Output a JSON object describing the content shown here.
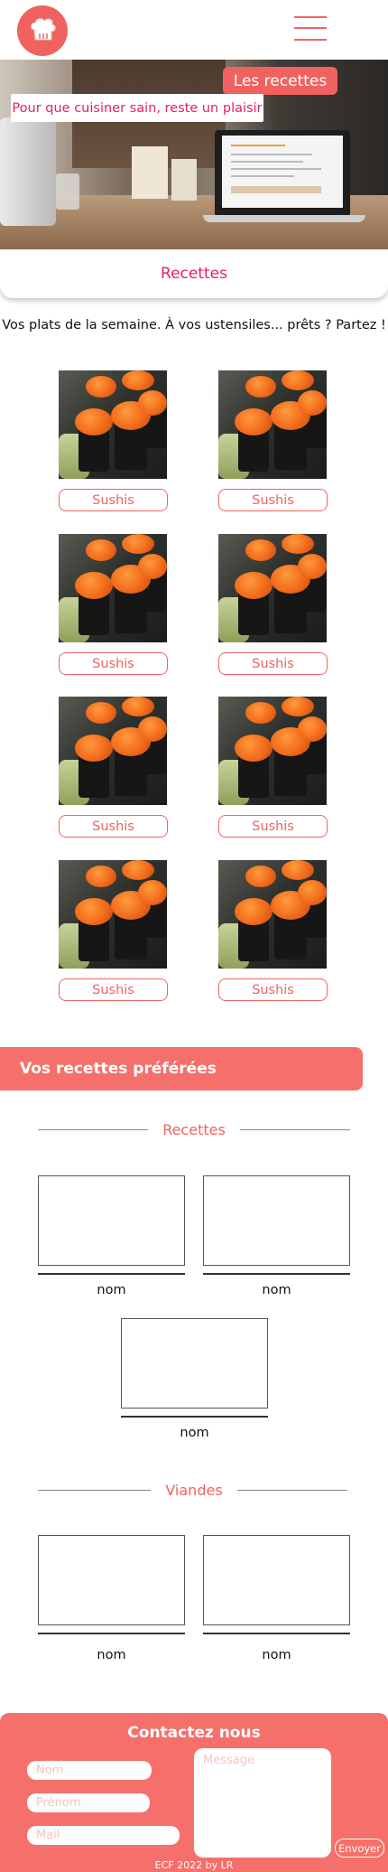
{
  "header": {
    "logo_icon": "chef-hat-icon",
    "menu_icon": "hamburger-menu-icon"
  },
  "hero": {
    "button_label": "Les recettes",
    "slogan": "Pour que cuisiner sain, reste un plaisir"
  },
  "tab": {
    "label": "Recettes"
  },
  "intro": "Vos plats de la semaine. À vos ustensiles... prêts ? Partez !",
  "weekly_recipes": [
    {
      "label": "Sushis"
    },
    {
      "label": "Sushis"
    },
    {
      "label": "Sushis"
    },
    {
      "label": "Sushis"
    },
    {
      "label": "Sushis"
    },
    {
      "label": "Sushis"
    },
    {
      "label": "Sushis"
    },
    {
      "label": "Sushis"
    }
  ],
  "favorites": {
    "banner": "Vos recettes préférées",
    "sections": [
      {
        "title": "Recettes",
        "items": [
          {
            "name": "nom"
          },
          {
            "name": "nom"
          },
          {
            "name": "nom"
          }
        ]
      },
      {
        "title": "Viandes",
        "items": [
          {
            "name": "nom"
          },
          {
            "name": "nom"
          }
        ]
      }
    ]
  },
  "contact": {
    "title": "Contactez nous",
    "nom_placeholder": "Nom",
    "prenom_placeholder": "Prénom",
    "mail_placeholder": "Mail",
    "message_placeholder": "Message",
    "send_label": "Envoyer",
    "copyright": "ECF 2022 by LR"
  },
  "colors": {
    "accent": "#f0625f",
    "highlight_text": "#e81e63",
    "banner": "#f5706b"
  }
}
